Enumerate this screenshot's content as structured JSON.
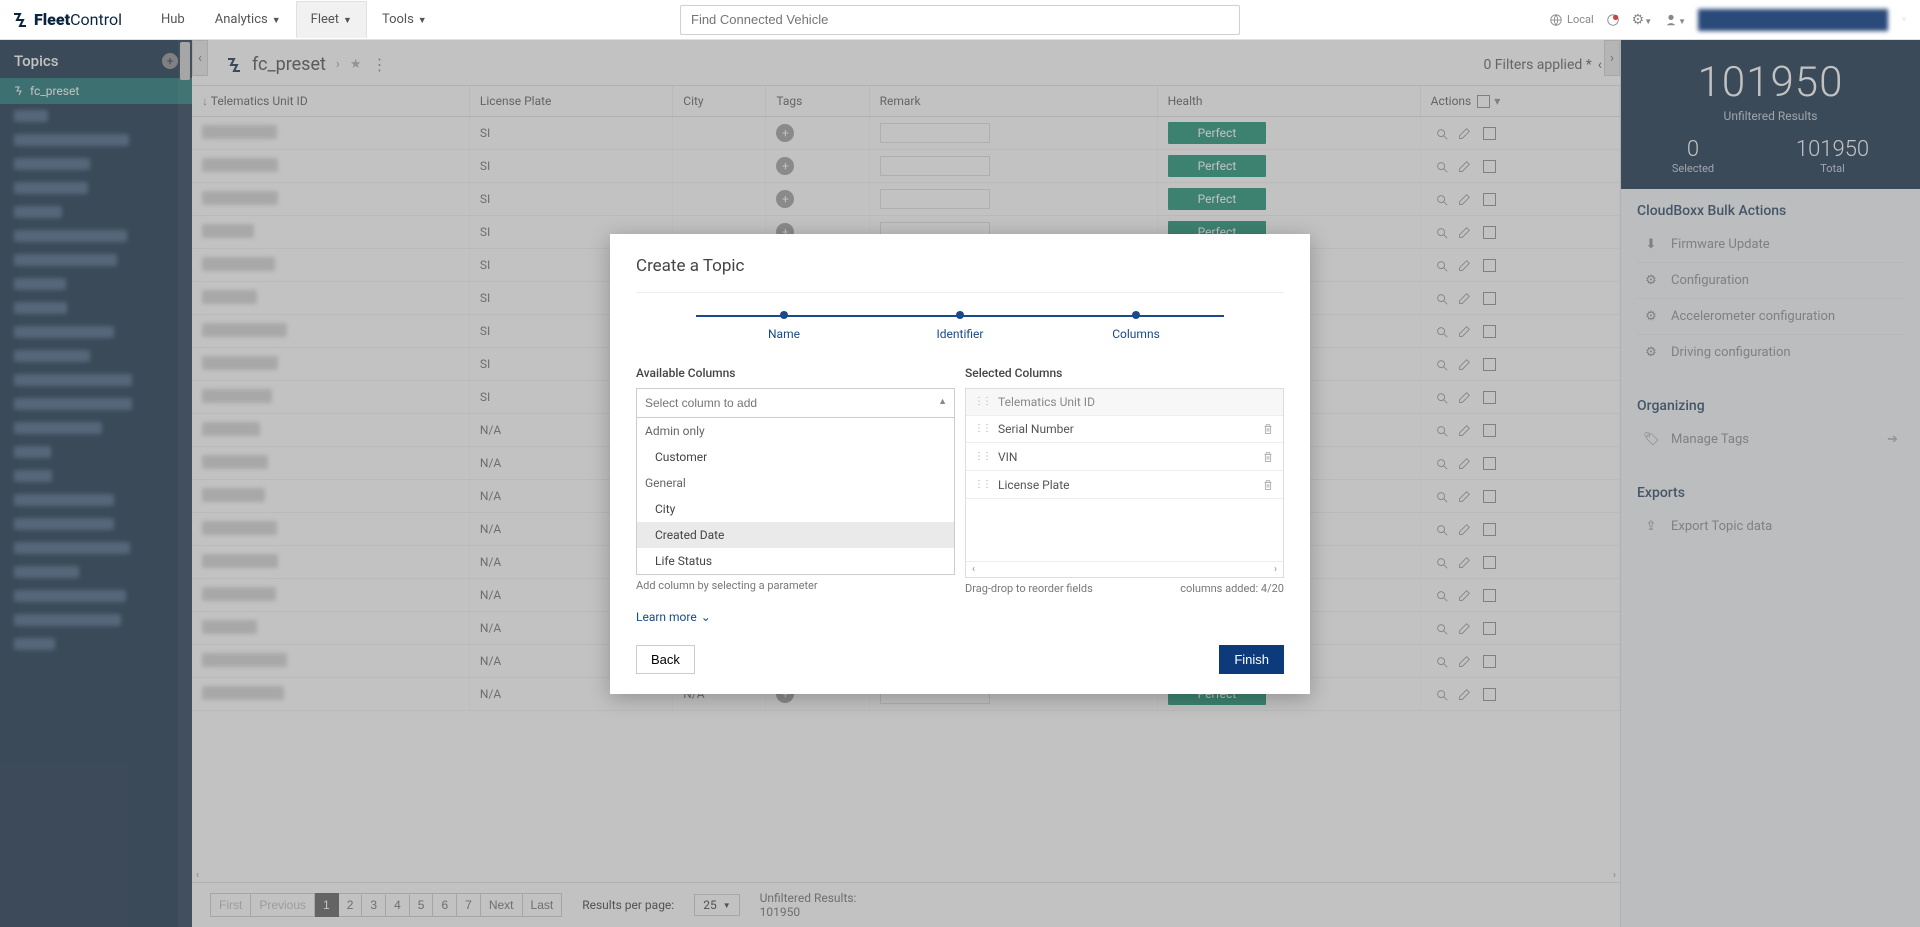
{
  "brand": {
    "name": "FleetControl",
    "bold": "Fleet",
    "sub": "Control"
  },
  "nav": {
    "items": [
      "Hub",
      "Analytics",
      "Fleet",
      "Tools"
    ],
    "active": 2,
    "search_placeholder": "Find Connected Vehicle",
    "local": "Local"
  },
  "sidebar": {
    "title": "Topics",
    "active_item": "fc_preset",
    "blurred_count": 23
  },
  "main": {
    "title": "fc_preset",
    "filters_label": "0 Filters applied *",
    "columns": [
      "Telematics Unit ID",
      "License Plate",
      "City",
      "Tags",
      "Remark",
      "Health",
      "Actions"
    ],
    "health_value": "Perfect",
    "plate_a": "SI",
    "plate_b": "N/A",
    "row_count": 18
  },
  "pagination": {
    "first": "First",
    "prev": "Previous",
    "next": "Next",
    "last": "Last",
    "pages": [
      "1",
      "2",
      "3",
      "4",
      "5",
      "6",
      "7"
    ],
    "results_per_page_label": "Results per page:",
    "per_page": "25",
    "unfiltered_label": "Unfiltered Results:",
    "unfiltered_value": "101950"
  },
  "rightpanel": {
    "big": "101950",
    "big_label": "Unfiltered Results",
    "selected_n": "0",
    "selected_l": "Selected",
    "total_n": "101950",
    "total_l": "Total",
    "bulk_title": "CloudBoxx Bulk Actions",
    "bulk_actions": [
      "Firmware Update",
      "Configuration",
      "Accelerometer configuration",
      "Driving configuration"
    ],
    "org_title": "Organizing",
    "org_action": "Manage Tags",
    "exp_title": "Exports",
    "exp_action": "Export Topic data"
  },
  "modal": {
    "title": "Create a Topic",
    "steps": [
      "Name",
      "Identifier",
      "Columns"
    ],
    "avail_title": "Available Columns",
    "sel_title": "Selected Columns",
    "avail_placeholder": "Select column to add",
    "groups": [
      {
        "label": "Admin only",
        "items": [
          "Customer"
        ]
      },
      {
        "label": "General",
        "items": [
          "City",
          "Created Date",
          "Life Status"
        ]
      }
    ],
    "highlighted": "Created Date",
    "selected": [
      {
        "label": "Telematics Unit ID",
        "locked": true
      },
      {
        "label": "Serial Number",
        "locked": false
      },
      {
        "label": "VIN",
        "locked": false
      },
      {
        "label": "License Plate",
        "locked": false
      }
    ],
    "avail_helper": "Add column by selecting a parameter",
    "drag_helper": "Drag-drop to reorder fields",
    "count_helper": "columns added: 4/20",
    "learn": "Learn more",
    "back": "Back",
    "finish": "Finish"
  }
}
